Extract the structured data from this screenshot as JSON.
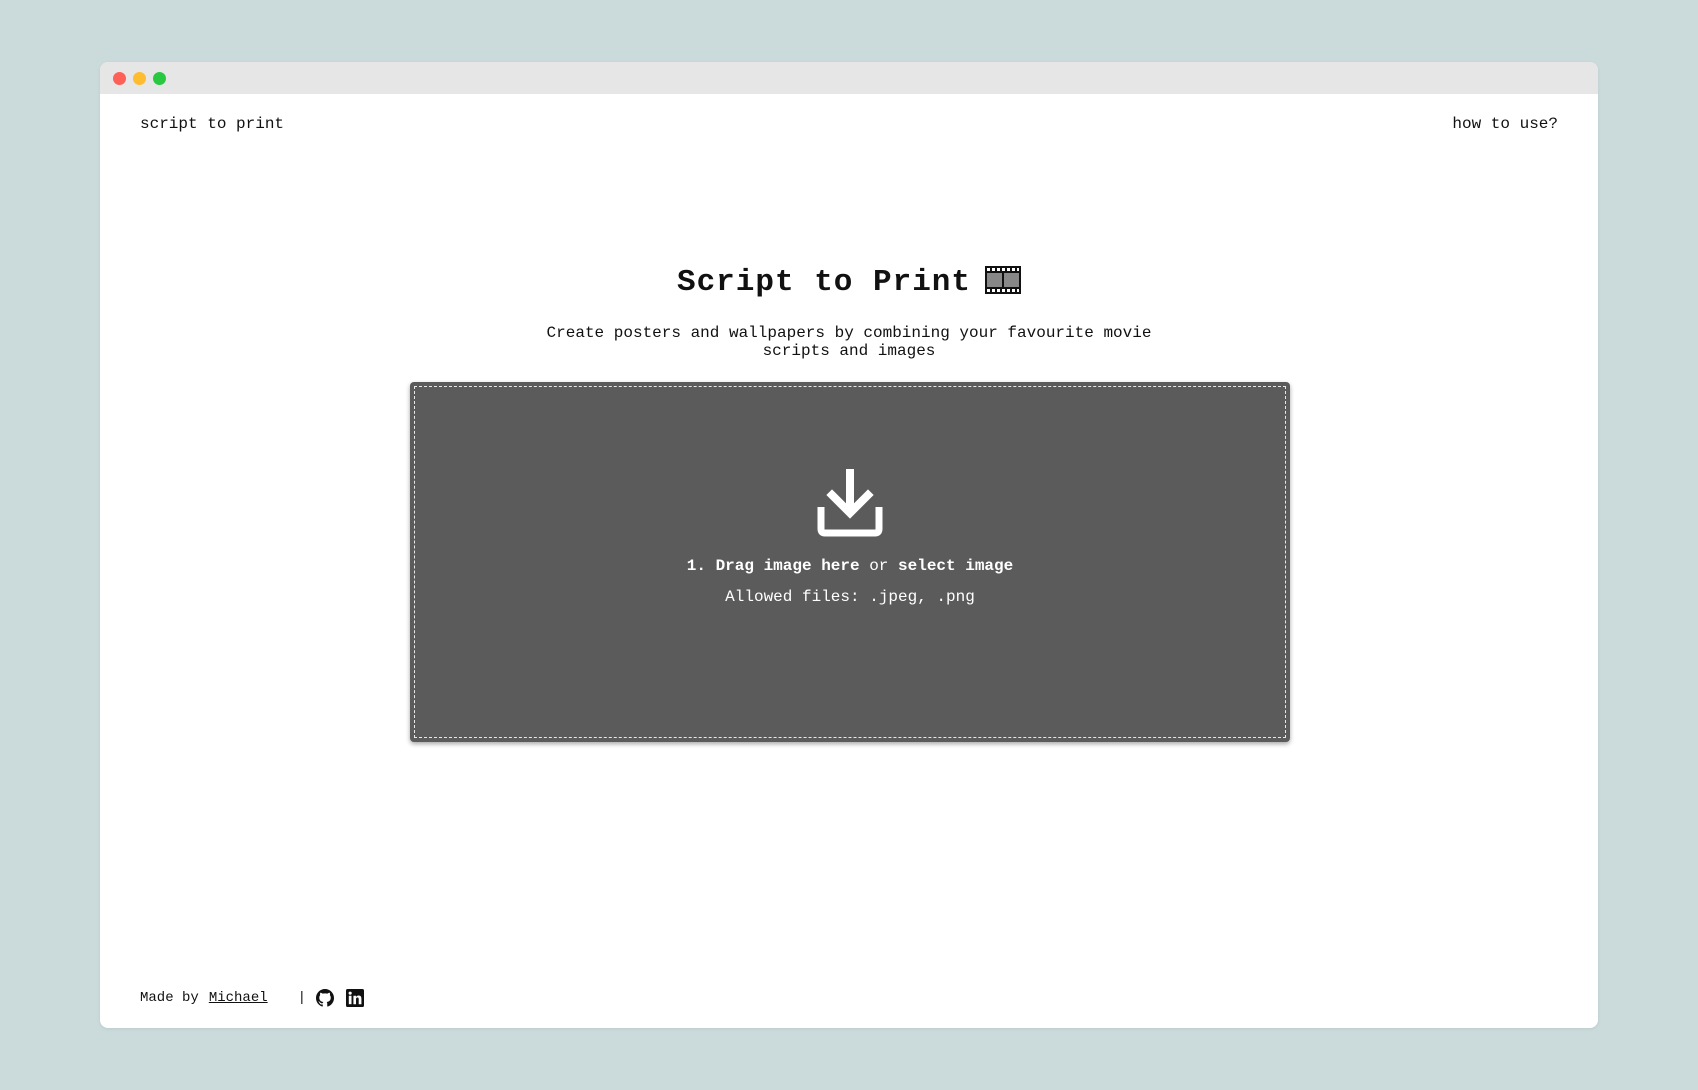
{
  "nav": {
    "brand": "script to print",
    "help_link": "how to use?"
  },
  "hero": {
    "title": "Script to Print",
    "title_icon": "film-frames-icon",
    "subtitle_line1": "Create posters and wallpapers by combining your favourite movie",
    "subtitle_line2": "scripts and images"
  },
  "dropzone": {
    "icon": "download-tray-icon",
    "step": "1. Drag image here",
    "or": "or",
    "select": "select image",
    "allowed": "Allowed files: .jpeg, .png"
  },
  "footer": {
    "made_by": "Made by",
    "author": "Michael",
    "separator": "|",
    "github_icon": "github-icon",
    "linkedin_icon": "linkedin-icon"
  },
  "colors": {
    "page_bg": "#cbdbdb",
    "window_bg": "#ffffff",
    "dropzone_bg": "#5b5b5b",
    "text": "#111111"
  }
}
